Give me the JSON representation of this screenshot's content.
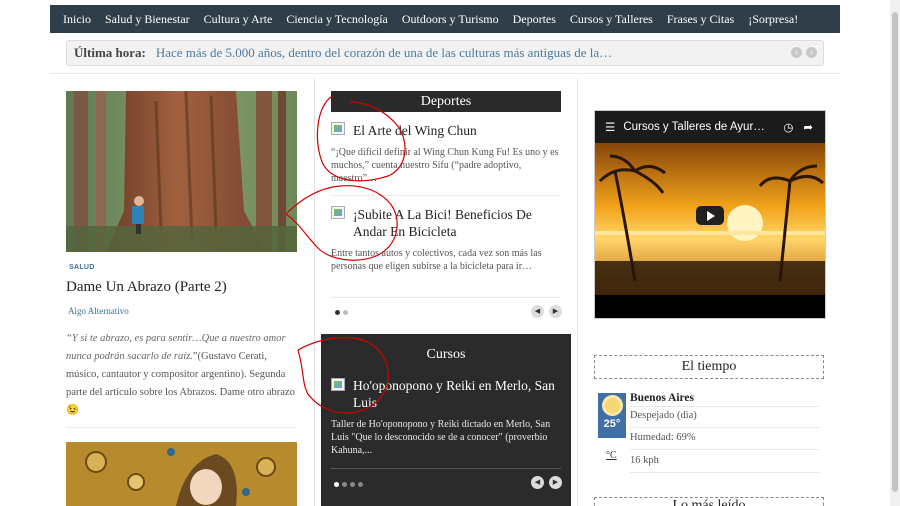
{
  "nav": {
    "items": [
      "Inicio",
      "Salud y Bienestar",
      "Cultura y Arte",
      "Ciencia y Tecnología",
      "Outdoors y Turismo",
      "Deportes",
      "Cursos y Talleres",
      "Frases y Citas",
      "¡Sorpresa!"
    ]
  },
  "ticker": {
    "label": "Última hora:",
    "text": "Hace más de 5.000 años, dentro del corazón de una de las culturas más antiguas de la…",
    "prev_icon": "chevron-left-icon",
    "next_icon": "chevron-right-icon"
  },
  "left_post": {
    "category": "SALUD",
    "title": "Dame Un Abrazo (Parte 2)",
    "author": "Algo Alternativo",
    "quote": "“Y si te abrazo, es para sentir…Que a nuestro amor nunca podrán sacarlo de raíz.",
    "excerpt_rest": "”(Gustavo Cerati, músico, cantautor y compositor argentino). Segunda parte del artículo sobre los Abrazos. Dame otro abrazo 😉"
  },
  "deportes": {
    "heading": "Deportes",
    "items": [
      {
        "title": "El Arte del Wing Chun",
        "excerpt": "“¡Que difícil definir al Wing Chun Kung Fu! Es uno y es muchos,” cuenta nuestro Sifu (“padre adoptivo, maestro”…"
      },
      {
        "title": "¡Subite A La Bici! Beneficios De Andar En Bicicleta",
        "excerpt": "Entre tantos autos y colectivos, cada vez son más las personas que eligen subirse a la bicicleta para ir…"
      }
    ]
  },
  "cursos": {
    "heading": "Cursos",
    "title": "Ho'oponopono y Reiki en Merlo, San Luis",
    "excerpt": "Taller de Ho'oponopono y Reiki dictado en Merlo, San Luis \"Que lo desconocido se de a conocer\" (proverbio Kahuna,..."
  },
  "video": {
    "title": "Cursos y Talleres de Ayur…"
  },
  "weather": {
    "heading": "El tiempo",
    "city": "Buenos Aires",
    "temp": "25°",
    "condition": "Despejado (dia)",
    "humidity": "Humedad: 69%",
    "unit": "°C",
    "wind": "16 kph"
  },
  "next_widget": {
    "heading": "Lo más leído"
  },
  "colors": {
    "nav_bg": "#2f3e48",
    "link": "#3d7196",
    "widget_head": "#2a2a2a",
    "annotation": "#d40000"
  }
}
